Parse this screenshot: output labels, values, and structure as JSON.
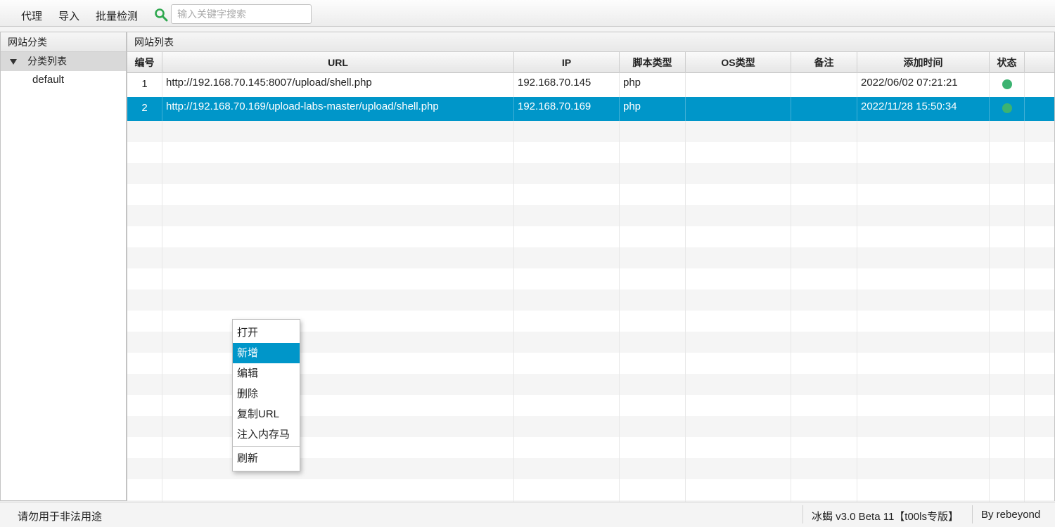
{
  "toolbar": {
    "menu": [
      "代理",
      "导入",
      "批量检测"
    ],
    "search_placeholder": "输入关键字搜索",
    "search_value": ""
  },
  "left_panel": {
    "title": "网站分类",
    "tree_root": "分类列表",
    "tree_items": [
      "default"
    ]
  },
  "right_panel": {
    "title": "网站列表",
    "columns": [
      "编号",
      "URL",
      "IP",
      "脚本类型",
      "OS类型",
      "备注",
      "添加时间",
      "状态"
    ],
    "rows": [
      {
        "id": "1",
        "url": "http://192.168.70.145:8007/upload/shell.php",
        "ip": "192.168.70.145",
        "script": "php",
        "os": "",
        "note": "",
        "time": "2022/06/02 07:21:21",
        "status": "online"
      },
      {
        "id": "2",
        "url": "http://192.168.70.169/upload-labs-master/upload/shell.php",
        "ip": "192.168.70.169",
        "script": "php",
        "os": "",
        "note": "",
        "time": "2022/11/28 15:50:34",
        "status": "online"
      }
    ],
    "selected_row": 2
  },
  "context_menu": {
    "items": [
      "打开",
      "新增",
      "编辑",
      "删除",
      "复制URL",
      "注入内存马",
      "刷新"
    ],
    "highlighted": "新增"
  },
  "statusbar": {
    "warning": "请勿用于非法用途",
    "version": "冰蝎 v3.0 Beta 11【t00ls专版】",
    "author": "By rebeyond"
  },
  "colors": {
    "selection": "#0096c9",
    "status_online": "#3cb371",
    "search_icon": "#2fa84f"
  }
}
